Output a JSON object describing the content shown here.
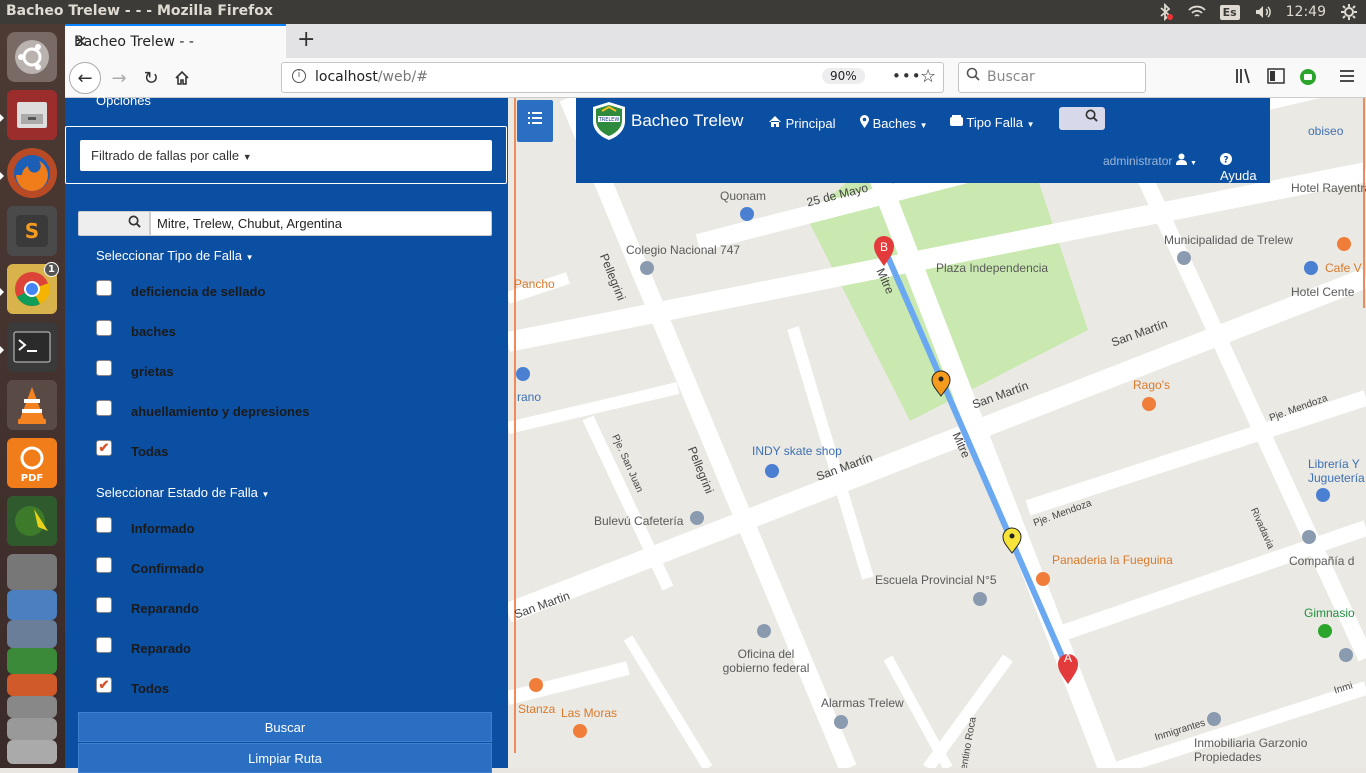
{
  "os": {
    "window_title": "Bacheo Trelew - - - Mozilla Firefox",
    "keyboard_layout": "Es",
    "clock": "12:49",
    "launcher_badge": "1",
    "launcher_pdf_label": "PDF"
  },
  "browser": {
    "tab_title": "Bacheo Trelew - -",
    "url_host": "localhost",
    "url_path": "/web/#",
    "zoom": "90%",
    "search_placeholder": "Buscar"
  },
  "sidebar": {
    "opciones": "Opciones",
    "filter_dropdown": "Filtrado de fallas por calle",
    "street_search_value": "Mitre, Trelew, Chubut, Argentina",
    "tipo_falla_title": "Seleccionar Tipo de Falla",
    "tipo_falla": [
      {
        "label": "deficiencia de sellado",
        "checked": false
      },
      {
        "label": "baches",
        "checked": false
      },
      {
        "label": "grietas",
        "checked": false
      },
      {
        "label": "ahuellamiento y depresiones",
        "checked": false
      },
      {
        "label": "Todas",
        "checked": true
      }
    ],
    "estado_falla_title": "Seleccionar Estado de Falla",
    "estado_falla": [
      {
        "label": "Informado",
        "checked": false
      },
      {
        "label": "Confirmado",
        "checked": false
      },
      {
        "label": "Reparando",
        "checked": false
      },
      {
        "label": "Reparado",
        "checked": false
      },
      {
        "label": "Todos",
        "checked": true
      }
    ],
    "buscar_button": "Buscar",
    "limpiar_button": "Limpiar Ruta"
  },
  "navbar": {
    "brand": "Bacheo Trelew",
    "logo_text": "TRELEW",
    "principal": "Principal",
    "baches": "Baches",
    "tipo_falla": "Tipo Falla",
    "user": "administrator",
    "ayuda": "Ayuda"
  },
  "map": {
    "marker_a": "A",
    "marker_b": "B",
    "streets": [
      "25 de Mayo",
      "Mitre",
      "Pellegrini",
      "San Martín",
      "Pje. Mendoza",
      "Rivadavia",
      "Pje. San Juan",
      "Inmigrantes",
      "entino Roca"
    ],
    "places": [
      "Quonam",
      "Colegio Nacional 747",
      "Plaza Independencia",
      "Pancho",
      "rano",
      "Municipalidad de Trelew",
      "Hotel Rayentray",
      "Hotel Cente",
      "Cafe V",
      "obiseo",
      "Rago's",
      "INDY skate shop",
      "Bulevú Cafetería",
      "Panaderia la Fueguina",
      "Escuela Provincial N°5",
      "Oficina del gobierno federal",
      "Alarmas Trelew",
      "Stanza",
      "Las Moras",
      "Librería Y Juguetería",
      "Compañía d",
      "Gimnasio",
      "Inmobiliaria Garzonio Propiedades",
      "Inmi",
      "San Martin"
    ],
    "colors": {
      "park": "#c9e9b0",
      "road": "#ffffff",
      "route": "#6aa9f2",
      "panel": "#0b4fa3"
    }
  }
}
